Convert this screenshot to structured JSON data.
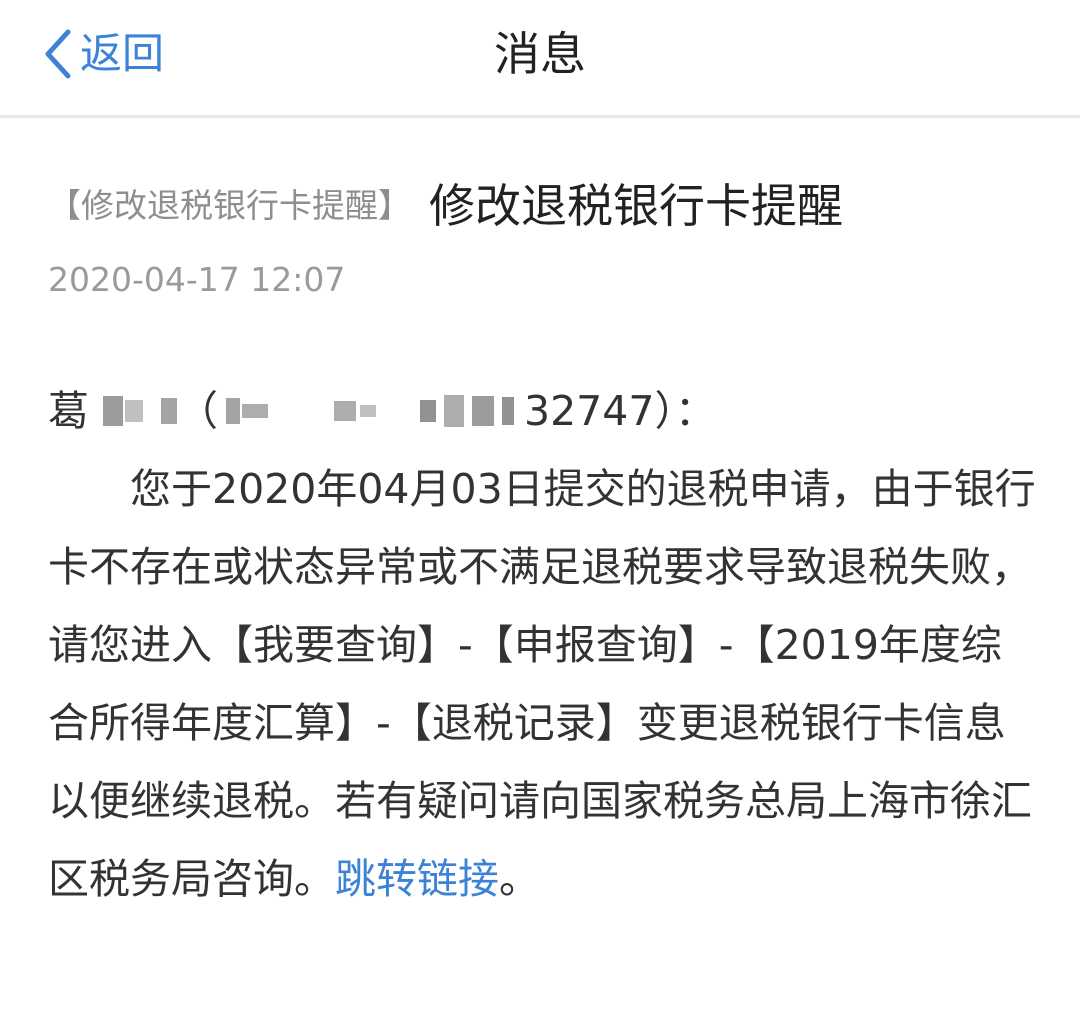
{
  "nav": {
    "back_label": "返回",
    "title": "消息"
  },
  "message": {
    "tag": "【修改退税银行卡提醒】",
    "subject": "修改退税银行卡提醒",
    "time": "2020-04-17 12:07",
    "salutation": {
      "name_visible": "葛",
      "open_paren": "（",
      "id_suffix": "32747",
      "close": "）："
    },
    "body": "您于2020年04月03日提交的退税申请，由于银行卡不存在或状态异常或不满足退税要求导致退税失败，请您进入【我要查询】-【申报查询】-【2019年度综合所得年度汇算】-【退税记录】变更退税银行卡信息以便继续退税。若有疑问请向国家税务总局上海市徐汇区税务局咨询。",
    "link_label": "跳转链接",
    "end": "。"
  },
  "colors": {
    "accent": "#3c82d6",
    "text": "#333333",
    "muted": "#9a9a9a",
    "divider": "#e8e8e8"
  },
  "icons": {
    "back": "chevron-left-icon"
  }
}
